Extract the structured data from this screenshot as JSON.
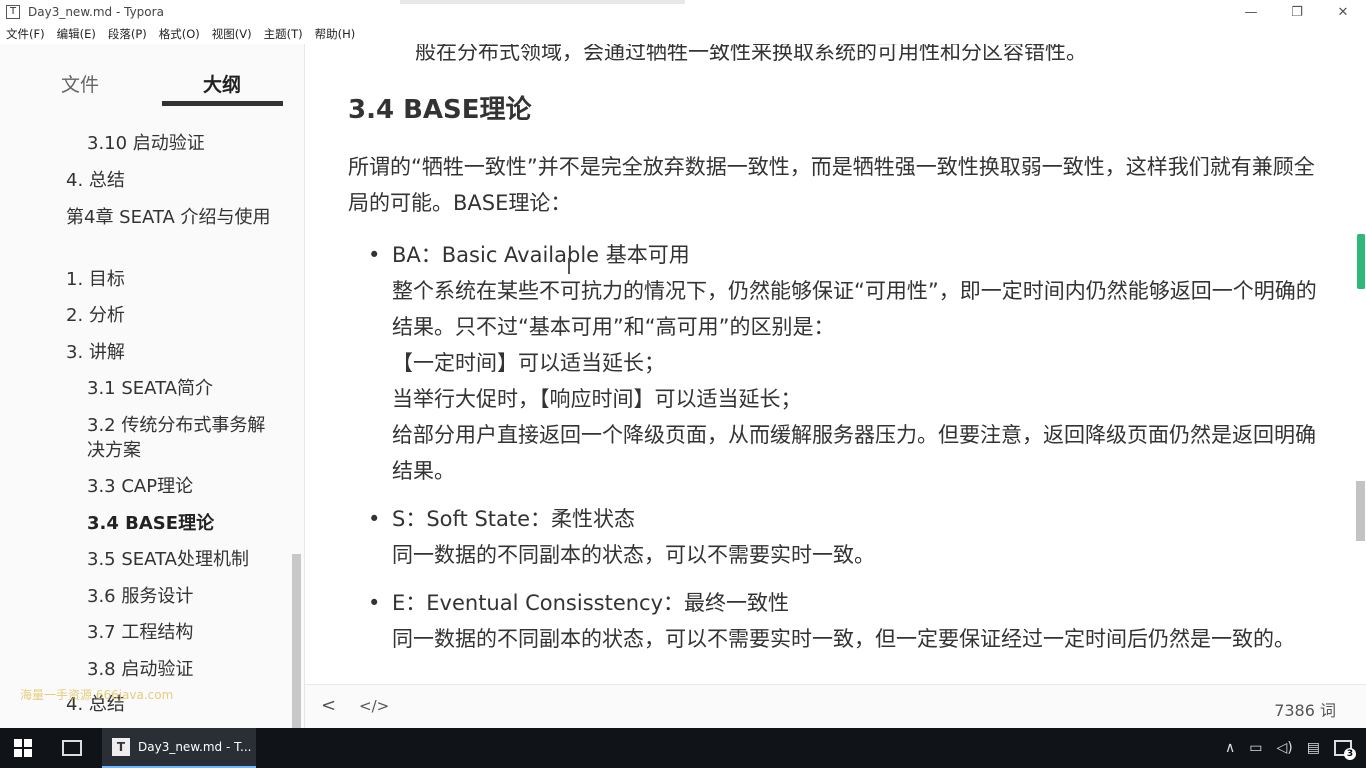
{
  "window": {
    "title": "Day3_new.md - Typora",
    "app_icon": "T",
    "minimize_glyph": "—",
    "maximize_glyph": "❐",
    "close_glyph": "✕"
  },
  "menu": [
    "文件(F)",
    "编辑(E)",
    "段落(P)",
    "格式(O)",
    "视图(V)",
    "主题(T)",
    "帮助(H)"
  ],
  "sidebar": {
    "tab_files": "文件",
    "tab_outline": "大纲",
    "items": [
      {
        "label": "3.10 启动验证",
        "level": 2
      },
      {
        "label": "4. 总结",
        "level": 1
      },
      {
        "label": "第4章 SEATA 介绍与使用",
        "level": 1
      },
      {
        "label": "1. 目标",
        "level": 1
      },
      {
        "label": "2. 分析",
        "level": 1
      },
      {
        "label": "3. 讲解",
        "level": 1
      },
      {
        "label": "3.1 SEATA简介",
        "level": 2
      },
      {
        "label": "3.2 传统分布式事务解决方案",
        "level": 2
      },
      {
        "label": "3.3 CAP理论",
        "level": 2
      },
      {
        "label": "3.4 BASE理论",
        "level": 2,
        "active": true
      },
      {
        "label": "3.5 SEATA处理机制",
        "level": 2
      },
      {
        "label": "3.6 服务设计",
        "level": 2
      },
      {
        "label": "3.7 工程结构",
        "level": 2
      },
      {
        "label": "3.8 启动验证",
        "level": 2
      },
      {
        "label": "4. 总结",
        "level": 1
      }
    ],
    "watermark": "海量一手资源 666java.com"
  },
  "content": {
    "clipped_line": "般在分布式领域，会通过牺牲一致性来换取系统的可用性和分区容错性。",
    "heading": "3.4 BASE理论",
    "intro": "所谓的“牺牲一致性”并不是完全放弃数据一致性，而是牺牲强一致性换取弱一致性，这样我们就有兼顾全局的可能。BASE理论：",
    "bullets": [
      {
        "lines": [
          "BA：Basic Available 基本可用",
          "整个系统在某些不可抗力的情况下，仍然能够保证“可用性”，即一定时间内仍然能够返回一个明确的结果。只不过“基本可用”和“高可用”的区别是：",
          "【一定时间】可以适当延长；",
          "当举行大促时，【响应时间】可以适当延长；",
          "给部分用户直接返回一个降级页面，从而缓解服务器压力。但要注意，返回降级页面仍然是返回明确结果。"
        ]
      },
      {
        "lines": [
          "S：Soft State：柔性状态",
          "同一数据的不同副本的状态，可以不需要实时一致。"
        ]
      },
      {
        "lines": [
          "E：Eventual Consisstency：最终一致性",
          "同一数据的不同副本的状态，可以不需要实时一致，但一定要保证经过一定时间后仍然是一致的。"
        ]
      }
    ]
  },
  "footer": {
    "back_glyph": "<",
    "source_glyph": "</>",
    "word_count": "7386 词"
  },
  "taskbar": {
    "app_label": "Day3_new.md - T...",
    "app_icon": "T",
    "tray_up": "∧",
    "notification_count": "3"
  }
}
